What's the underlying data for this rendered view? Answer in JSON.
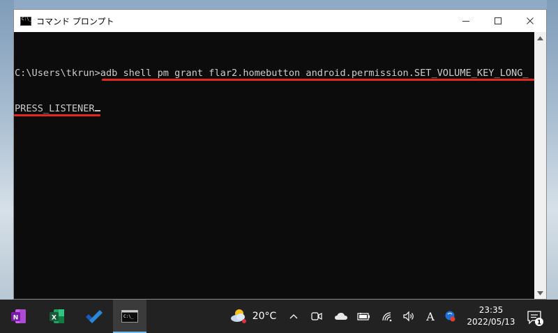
{
  "window": {
    "title": "コマンド プロンプト",
    "controls": {
      "minimize": "minimize-icon",
      "maximize": "maximize-icon",
      "close": "close-icon"
    }
  },
  "console": {
    "line1": "C:\\Users\\tkrun>adb shell pm grant flar2.homebutton android.permission.SET_VOLUME_KEY_LONG_",
    "line2": "PRESS_LISTENER"
  },
  "taskbar": {
    "apps": [
      {
        "name": "onenote",
        "icon": "onenote-icon"
      },
      {
        "name": "excel",
        "icon": "excel-icon"
      },
      {
        "name": "todo",
        "icon": "todo-icon"
      },
      {
        "name": "command-prompt",
        "icon": "cmd-icon",
        "active": true
      }
    ],
    "weather": {
      "temp": "20°C",
      "icon": "weather-icon"
    },
    "tray": {
      "ime_mode": "A"
    },
    "clock": {
      "time": "23:35",
      "date": "2022/05/13"
    },
    "notifications": {
      "count": "1"
    }
  },
  "colors": {
    "console_bg": "#0c0c0c",
    "console_text": "#cccccc",
    "highlight": "#e12a1f",
    "taskbar_bg": "#222222"
  }
}
